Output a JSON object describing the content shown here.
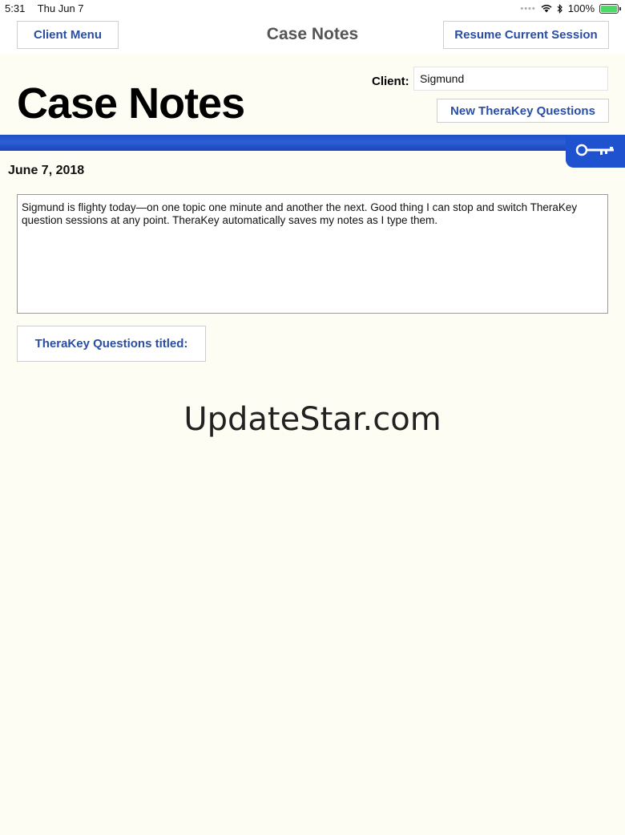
{
  "status_bar": {
    "time": "5:31",
    "date": "Thu Jun 7",
    "battery": "100%"
  },
  "nav": {
    "title": "Case Notes",
    "client_menu_label": "Client Menu",
    "resume_label": "Resume Current Session"
  },
  "header": {
    "title": "Case Notes",
    "client_label": "Client:",
    "client_value": "Sigmund",
    "new_questions_label": "New TheraKey Questions"
  },
  "notes": {
    "date": "June 7, 2018",
    "text": "Sigmund is flighty today—on one topic one minute and another the next. Good thing I can stop and switch TheraKey question sessions at any point. TheraKey automatically saves my notes as I type them.",
    "questions_titled_label": "TheraKey Questions titled:"
  },
  "watermark": "UpdateStar.com",
  "colors": {
    "accent_blue": "#2a4ea3",
    "stripe_blue": "#1f52cf",
    "background": "#fefdf3",
    "battery_green": "#4cd964"
  }
}
